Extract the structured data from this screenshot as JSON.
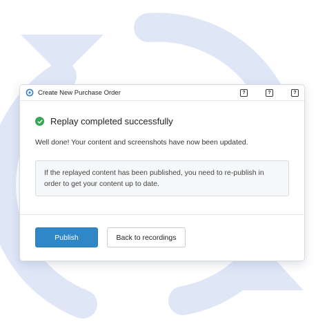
{
  "dialog": {
    "title": "Create New Purchase Order",
    "titlebar_buttons": [
      "?",
      "?",
      "?"
    ],
    "status_title": "Replay completed successfully",
    "message": "Well done! Your content and screenshots have now been updated.",
    "notice": "If the replayed content has been published, you need to re-publish in order to get your content up to date.",
    "publish_label": "Publish",
    "back_label": "Back to recordings"
  },
  "colors": {
    "background_art": "#dfe7f7",
    "primary_button": "#2f87c8",
    "success": "#35a853",
    "app_icon": "#3a7fc1"
  }
}
